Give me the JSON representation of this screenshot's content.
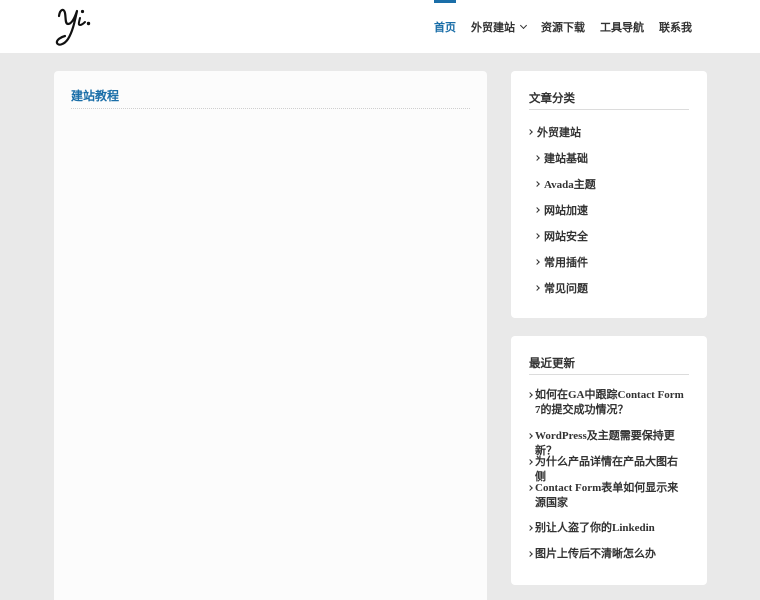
{
  "header": {
    "logo_text": "yi.",
    "nav": [
      {
        "label": "首页",
        "active": true
      },
      {
        "label": "外贸建站",
        "has_dropdown": true
      },
      {
        "label": "资源下载"
      },
      {
        "label": "工具导航"
      },
      {
        "label": "联系我"
      }
    ]
  },
  "main": {
    "title": "建站教程"
  },
  "sidebar": {
    "categories": {
      "title": "文章分类",
      "items": [
        {
          "label": "外贸建站",
          "level": 0
        },
        {
          "label": "建站基础",
          "level": 1
        },
        {
          "label": "Avada主题",
          "level": 1
        },
        {
          "label": "网站加速",
          "level": 1
        },
        {
          "label": "网站安全",
          "level": 1
        },
        {
          "label": "常用插件",
          "level": 1
        },
        {
          "label": "常见问题",
          "level": 1
        }
      ]
    },
    "recent": {
      "title": "最近更新",
      "items": [
        {
          "label": "如何在GA中跟踪Contact Form 7的提交成功情况？"
        },
        {
          "label": "WordPress及主题需要保持更新？"
        },
        {
          "label": "为什么产品详情在产品大图右侧"
        },
        {
          "label": "Contact Form表单如何显示来源国家"
        },
        {
          "label": "别让人盗了你的Linkedin"
        },
        {
          "label": "图片上传后不清晰怎么办"
        }
      ]
    }
  },
  "colors": {
    "accent": "#1a6ea8",
    "background": "#e9e9e9",
    "card": "#ffffff",
    "text": "#333333"
  }
}
